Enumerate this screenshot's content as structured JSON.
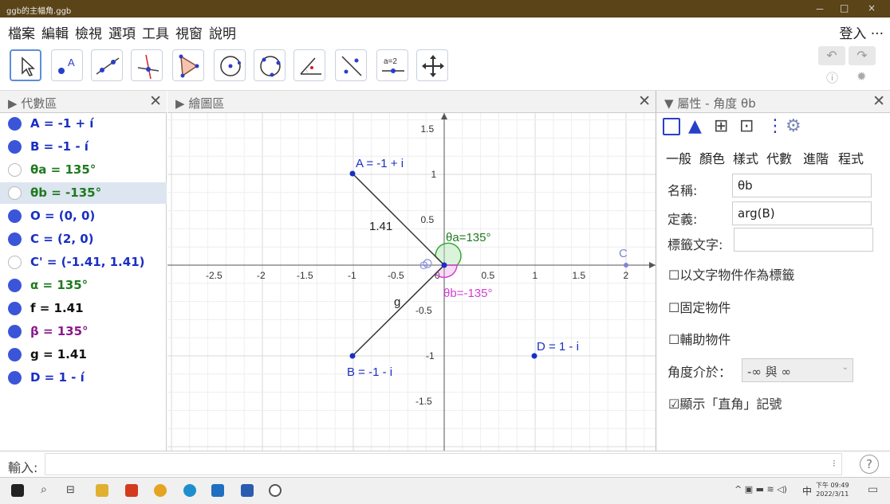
{
  "window": {
    "title": "ggb的主幅角.ggb",
    "controls": [
      "－",
      "□",
      "×"
    ]
  },
  "menu": {
    "items": [
      "檔案",
      "編輯",
      "檢視",
      "選項",
      "工具",
      "視窗",
      "說明"
    ],
    "login": "登入 ···"
  },
  "toolbar": {
    "equation_tool_label": "a=2"
  },
  "algebra": {
    "title": "代數區",
    "items": [
      {
        "label": "A = -1 + í",
        "color": "#1a2fc2",
        "visible": true
      },
      {
        "label": "B = -1 - í",
        "color": "#1a2fc2",
        "visible": true
      },
      {
        "label": "θa = 135°",
        "color": "#1f7a1f",
        "visible": false
      },
      {
        "label": "θb = -135°",
        "color": "#1f7a1f",
        "visible": false,
        "selected": true
      },
      {
        "label": "O = (0, 0)",
        "color": "#1a2fc2",
        "visible": true
      },
      {
        "label": "C = (2, 0)",
        "color": "#1a2fc2",
        "visible": true
      },
      {
        "label": "C' = (-1.41, 1.41)",
        "color": "#1a2fc2",
        "visible": false
      },
      {
        "label": "α = 135°",
        "color": "#1f7a1f",
        "visible": true
      },
      {
        "label": "f = 1.41",
        "color": "#111111",
        "visible": true
      },
      {
        "label": "β = 135°",
        "color": "#8b1a8b",
        "visible": true
      },
      {
        "label": "g = 1.41",
        "color": "#111111",
        "visible": true
      },
      {
        "label": "D = 1 - í",
        "color": "#1a2fc2",
        "visible": true
      }
    ]
  },
  "graphics": {
    "title": "繪圖區",
    "x_ticks": [
      "-2.5",
      "-2",
      "-1.5",
      "-1",
      "-0.5",
      "0",
      "0.5",
      "1",
      "1.5",
      "2"
    ],
    "y_ticks": [
      "1.5",
      "1",
      "0.5",
      "-0.5",
      "-1",
      "-1.5"
    ],
    "labels": {
      "A": "A = -1 + i",
      "B": "B = -1 - i",
      "D": "D = 1 - i",
      "C": "C",
      "O": "O",
      "f": "1.41",
      "g": "g",
      "theta_a": "θa=135°",
      "theta_b": "θb=-135°"
    }
  },
  "properties": {
    "title": "屬性 - 角度 θb",
    "tabs": [
      "一般",
      "顏色",
      "樣式",
      "代數",
      "進階",
      "程式"
    ],
    "name_label": "名稱:",
    "name_value": "θb",
    "definition_label": "定義:",
    "definition_value": "arg(B)",
    "caption_label": "標籤文字:",
    "caption_value": "",
    "checkboxes": [
      {
        "label": "以文字物件作為標籤",
        "checked": false
      },
      {
        "label": "固定物件",
        "checked": false
      },
      {
        "label": "輔助物件",
        "checked": false
      }
    ],
    "angle_range_label": "角度介於：",
    "angle_range_value": "-∞ 與 ∞",
    "show_right_angle": {
      "label": "顯示「直角」記號",
      "checked": true
    }
  },
  "input": {
    "label": "輸入:",
    "value": "",
    "help": "?"
  },
  "taskbar": {
    "time": "下午 09:49",
    "date": "2022/3/11",
    "ime": "中"
  }
}
